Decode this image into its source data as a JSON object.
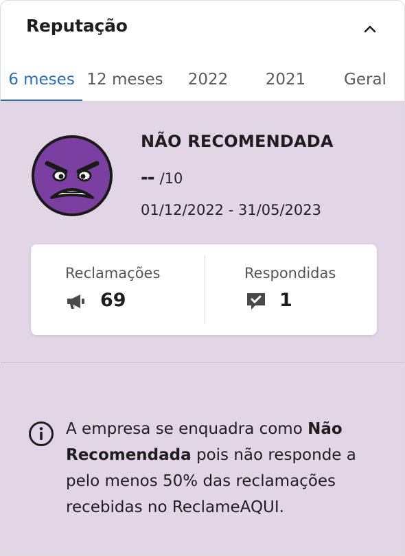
{
  "header": {
    "title": "Reputação",
    "toggle_icon": "chevron-up-icon"
  },
  "tabs": [
    {
      "label": "6 meses",
      "active": true
    },
    {
      "label": "12 meses",
      "active": false
    },
    {
      "label": "2022",
      "active": false
    },
    {
      "label": "2021",
      "active": false
    },
    {
      "label": "Geral",
      "active": false
    }
  ],
  "reputation": {
    "status": "NÃO RECOMENDADA",
    "score": "--",
    "score_suffix": "/10",
    "period": "01/12/2022 - 31/05/2023",
    "face_icon": "angry-face-icon"
  },
  "stats": {
    "complaints": {
      "label": "Reclamações",
      "value": "69",
      "icon": "megaphone-icon"
    },
    "answered": {
      "label": "Respondidas",
      "value": "1",
      "icon": "chat-check-icon"
    }
  },
  "info": {
    "icon": "info-icon",
    "text_before": "A empresa se enquadra como ",
    "text_bold": "Não Recomendada",
    "text_after": " pois não responde a pelo menos 50% das reclamações recebidas no ReclameAQUI."
  },
  "colors": {
    "accent": "#2d6db5",
    "panel_bg": "#e2d6e6",
    "face": "#7a3fa0"
  }
}
